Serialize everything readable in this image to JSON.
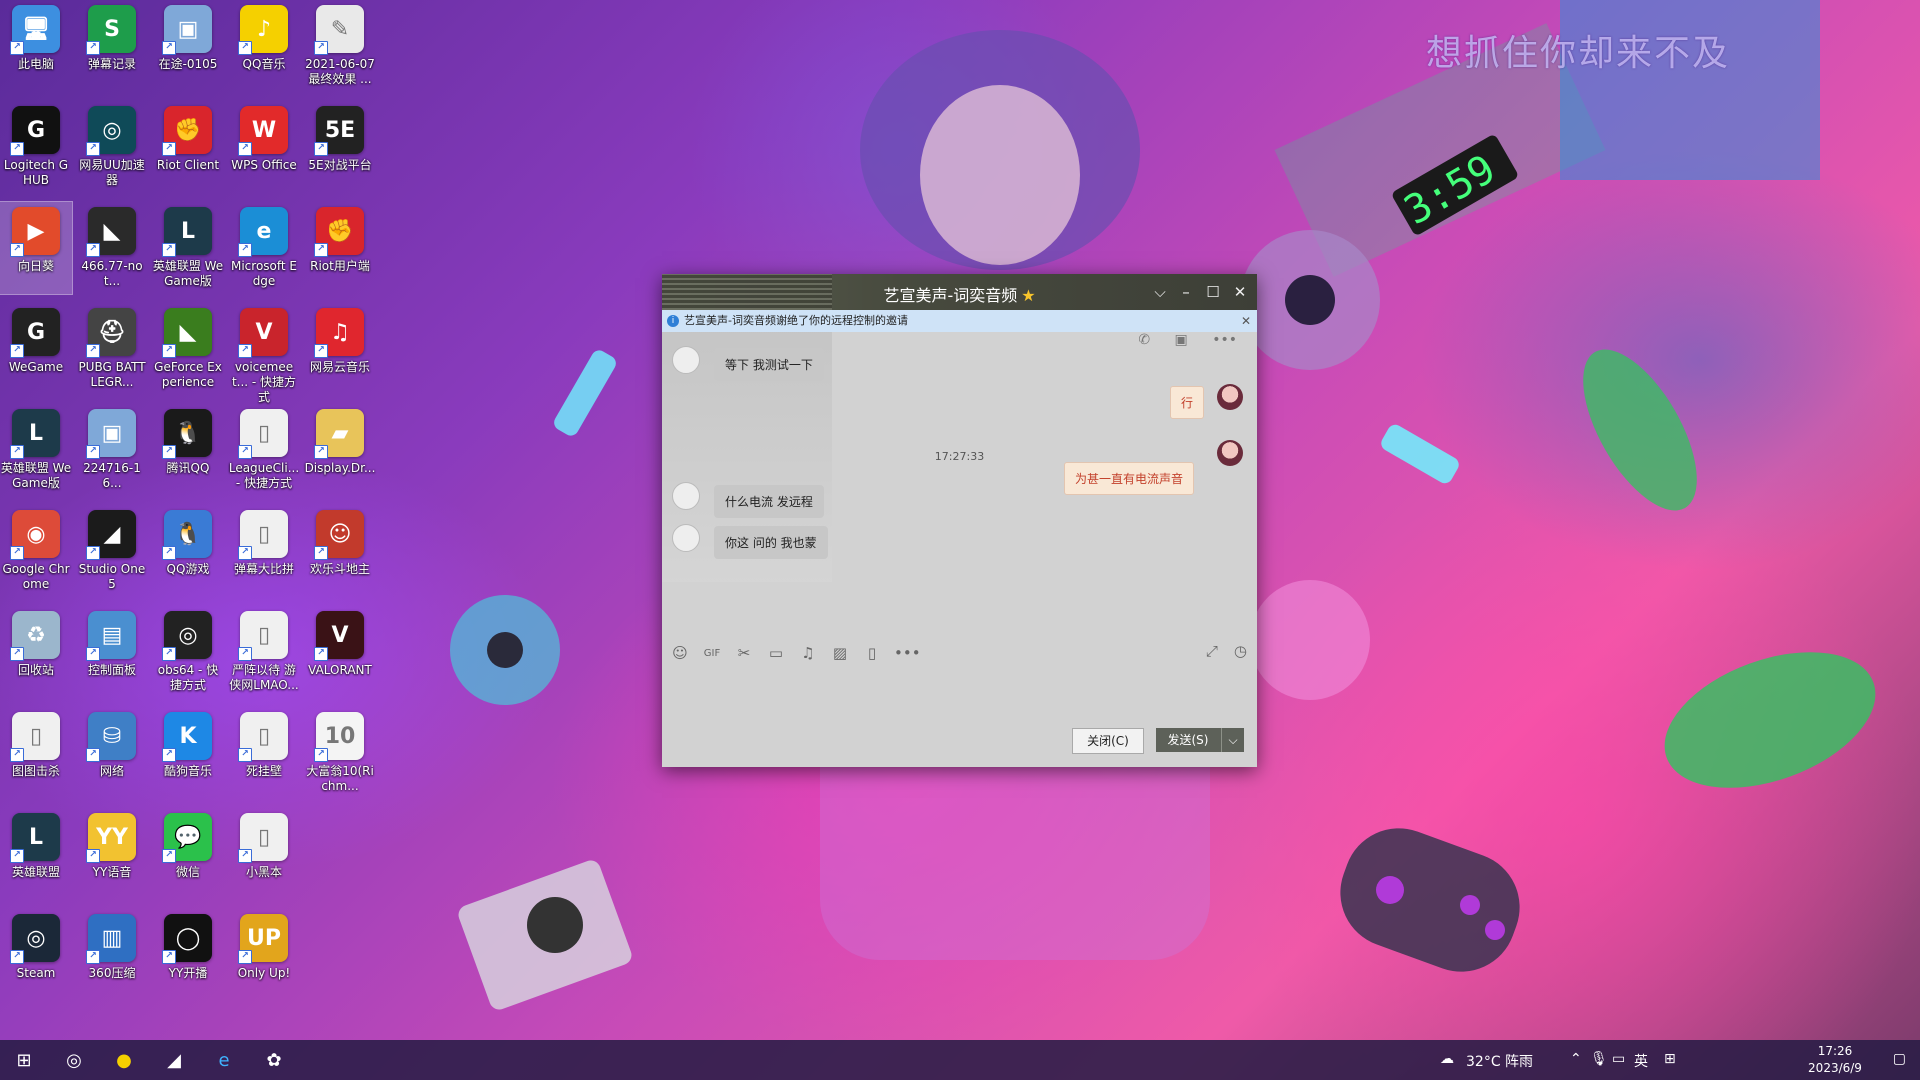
{
  "wallpaper_lyric": "想抓住你却来不及",
  "desktop_icons": [
    {
      "label": "此电脑",
      "icon": "computer-icon",
      "color": "#3d8fe0",
      "glyph": "🖥"
    },
    {
      "label": "弹幕记录",
      "icon": "sheet-icon",
      "color": "#1e9d4b",
      "glyph": "S"
    },
    {
      "label": "在途-0105",
      "icon": "image-file-icon",
      "color": "#7fa8d8",
      "glyph": "▣"
    },
    {
      "label": "QQ音乐",
      "icon": "qqmusic-icon",
      "color": "#f5d000",
      "glyph": "♪"
    },
    {
      "label": "2021-06-07 最终效果 ...",
      "icon": "document-icon",
      "color": "#e9e9e9",
      "glyph": "✎"
    },
    {
      "label": "Logitech G HUB",
      "icon": "logitech-icon",
      "color": "#111111",
      "glyph": "G"
    },
    {
      "label": "网易UU加速器",
      "icon": "uu-icon",
      "color": "#0f4a58",
      "glyph": "◎"
    },
    {
      "label": "Riot Client",
      "icon": "riot-icon",
      "color": "#d9252c",
      "glyph": "✊"
    },
    {
      "label": "WPS Office",
      "icon": "wps-icon",
      "color": "#e22a2a",
      "glyph": "W"
    },
    {
      "label": "5E对战平台",
      "icon": "5e-icon",
      "color": "#222222",
      "glyph": "5E"
    },
    {
      "label": "向日葵",
      "icon": "sunflower-icon",
      "color": "#e24b2b",
      "glyph": "▶"
    },
    {
      "label": "466.77-not...",
      "icon": "nvidia-icon",
      "color": "#2a2a2a",
      "glyph": "◣"
    },
    {
      "label": "英雄联盟 WeGame版",
      "icon": "lol-icon",
      "color": "#1d3a4a",
      "glyph": "L"
    },
    {
      "label": "Microsoft Edge",
      "icon": "edge-icon",
      "color": "#1b8ed6",
      "glyph": "e"
    },
    {
      "label": "Riot用户端",
      "icon": "riot-icon",
      "color": "#d9252c",
      "glyph": "✊"
    },
    {
      "label": "WeGame",
      "icon": "wegame-icon",
      "color": "#222222",
      "glyph": "G"
    },
    {
      "label": "PUBG BATTLEGR...",
      "icon": "pubg-icon",
      "color": "#444444",
      "glyph": "⛑"
    },
    {
      "label": "GeForce Experience",
      "icon": "geforce-icon",
      "color": "#3a7d1e",
      "glyph": "◣"
    },
    {
      "label": "voicemeet... - 快捷方式",
      "icon": "voicemeeter-icon",
      "color": "#c9242c",
      "glyph": "V"
    },
    {
      "label": "网易云音乐",
      "icon": "netease-music-icon",
      "color": "#e0262e",
      "glyph": "♫"
    },
    {
      "label": "英雄联盟 WeGame版",
      "icon": "lol-icon",
      "color": "#1d3a4a",
      "glyph": "L"
    },
    {
      "label": "224716-16...",
      "icon": "image-file-icon",
      "color": "#7fa8d8",
      "glyph": "▣"
    },
    {
      "label": "腾讯QQ",
      "icon": "qq-icon",
      "color": "#1a1a1a",
      "glyph": "🐧"
    },
    {
      "label": "LeagueCli... - 快捷方式",
      "icon": "file-icon",
      "color": "#f0f0f0",
      "glyph": "▯"
    },
    {
      "label": "Display.Dr...",
      "icon": "folder-icon",
      "color": "#e8c45a",
      "glyph": "▰"
    },
    {
      "label": "Google Chrome",
      "icon": "chrome-icon",
      "color": "#dd4b39",
      "glyph": "◉"
    },
    {
      "label": "Studio One 5",
      "icon": "studio-one-icon",
      "color": "#1b1b1b",
      "glyph": "◢"
    },
    {
      "label": "QQ游戏",
      "icon": "qqgame-icon",
      "color": "#3a7bd5",
      "glyph": "🐧"
    },
    {
      "label": "弹幕大比拼",
      "icon": "file-icon",
      "color": "#f0f0f0",
      "glyph": "▯"
    },
    {
      "label": "欢乐斗地主",
      "icon": "doudizhu-icon",
      "color": "#c23a2c",
      "glyph": "☺"
    },
    {
      "label": "回收站",
      "icon": "recycle-bin-icon",
      "color": "#9bb6cc",
      "glyph": "♻"
    },
    {
      "label": "控制面板",
      "icon": "control-panel-icon",
      "color": "#4a8fd0",
      "glyph": "▤"
    },
    {
      "label": "obs64 - 快捷方式",
      "icon": "obs-icon",
      "color": "#222222",
      "glyph": "◎"
    },
    {
      "label": "严阵以待 游侠网LMAO...",
      "icon": "file-icon",
      "color": "#f0f0f0",
      "glyph": "▯"
    },
    {
      "label": "VALORANT",
      "icon": "valorant-icon",
      "color": "#3a1216",
      "glyph": "V"
    },
    {
      "label": "图图击杀",
      "icon": "file-icon",
      "color": "#f0f0f0",
      "glyph": "▯"
    },
    {
      "label": "网络",
      "icon": "network-icon",
      "color": "#3f7fc6",
      "glyph": "⛁"
    },
    {
      "label": "酷狗音乐",
      "icon": "kugou-icon",
      "color": "#1e88e5",
      "glyph": "K"
    },
    {
      "label": "死挂壁",
      "icon": "file-icon",
      "color": "#f0f0f0",
      "glyph": "▯"
    },
    {
      "label": "大富翁10(Richm...",
      "icon": "richman-icon",
      "color": "#f4f4f4",
      "glyph": "10"
    },
    {
      "label": "英雄联盟",
      "icon": "lol-icon",
      "color": "#1d3a4a",
      "glyph": "L"
    },
    {
      "label": "YY语音",
      "icon": "yy-icon",
      "color": "#f2c230",
      "glyph": "YY"
    },
    {
      "label": "微信",
      "icon": "wechat-icon",
      "color": "#2bc14b",
      "glyph": "💬"
    },
    {
      "label": "小黑本",
      "icon": "file-icon",
      "color": "#f0f0f0",
      "glyph": "▯"
    },
    {
      "label": "",
      "icon": "",
      "color": "",
      "glyph": ""
    },
    {
      "label": "Steam",
      "icon": "steam-icon",
      "color": "#1b2838",
      "glyph": "◎"
    },
    {
      "label": "360压缩",
      "icon": "archive-icon",
      "color": "#2f6fc2",
      "glyph": "▥"
    },
    {
      "label": "YY开播",
      "icon": "yy-live-icon",
      "color": "#111111",
      "glyph": "◯"
    },
    {
      "label": "Only Up!",
      "icon": "onlyup-icon",
      "color": "#e2a51c",
      "glyph": "UP"
    }
  ],
  "chat": {
    "title": "艺宣美声-词奕音频",
    "star": "★",
    "notice": "艺宣美声-词奕音频谢绝了你的远程控制的邀请",
    "messages": [
      {
        "side": "left",
        "text": "等下 我测试一下"
      },
      {
        "side": "right",
        "text": "行"
      },
      {
        "side": "time",
        "text": "17:27:33"
      },
      {
        "side": "right",
        "text": "为甚一直有电流声音"
      },
      {
        "side": "left",
        "text": "什么电流 发远程"
      },
      {
        "side": "left",
        "text": "你这 问的 我也蒙"
      }
    ],
    "close_button": "关闭(C)",
    "send_button": "发送(S)"
  },
  "taskbar": {
    "weather": "32°C 阵雨",
    "ime": "英",
    "time": "17:26",
    "date": "2023/6/9"
  }
}
